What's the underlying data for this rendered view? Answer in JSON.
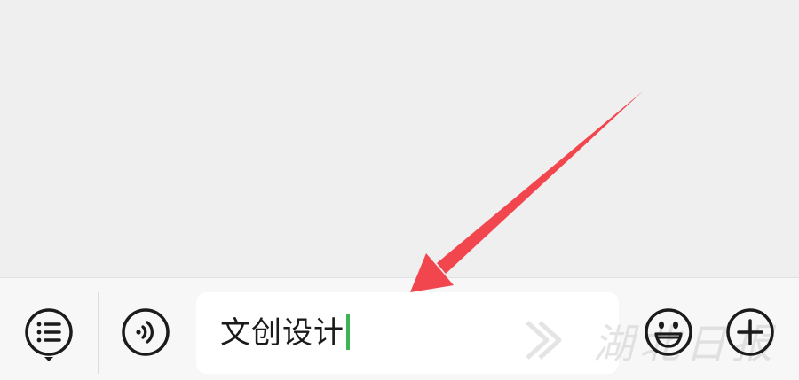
{
  "input": {
    "value": "文创设计"
  },
  "icons": {
    "menu": "list-icon",
    "voice": "voice-icon",
    "emoji": "emoji-icon",
    "add": "plus-icon"
  },
  "annotation": {
    "arrow_color": "#f2464f"
  },
  "watermark": {
    "text": "湖北日报"
  },
  "colors": {
    "background": "#efefef",
    "input_bar": "#f7f7f7",
    "caret": "#3fb455",
    "icon_stroke": "#1b1b1b"
  }
}
